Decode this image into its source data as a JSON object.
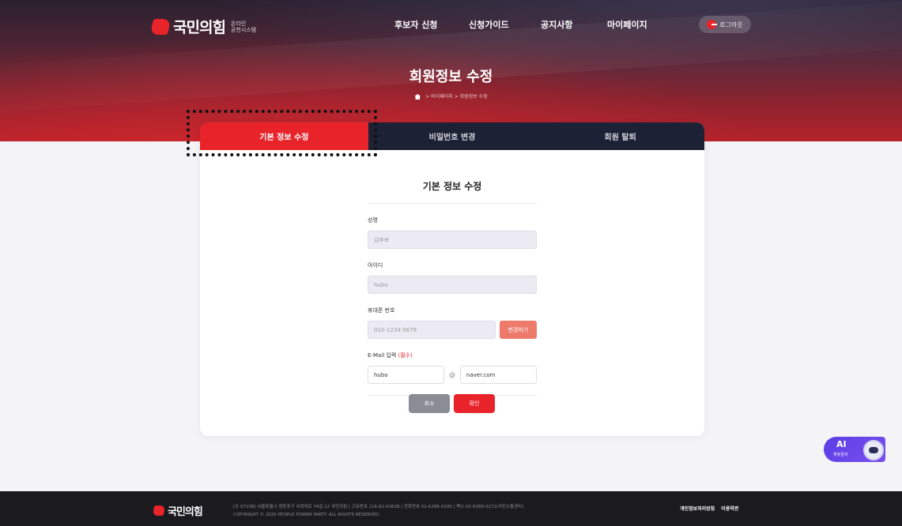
{
  "header": {
    "logo_text": "국민의힘",
    "logo_sub_line1": "온라인",
    "logo_sub_line2": "공천시스템",
    "nav": [
      "후보자 신청",
      "신청가이드",
      "공지사항",
      "마이페이지"
    ],
    "logout_label": "로그아웃"
  },
  "page": {
    "title": "회원정보 수정",
    "breadcrumb": [
      "마이페이지",
      "회원정보 수정"
    ]
  },
  "tabs": [
    {
      "label": "기본 정보 수정",
      "active": true
    },
    {
      "label": "비밀번호 변경",
      "active": false
    },
    {
      "label": "회원 탈퇴",
      "active": false
    }
  ],
  "form": {
    "title": "기본 정보 수정",
    "name_label": "성명",
    "name_value": "김후보",
    "id_label": "아이디",
    "id_value": "hubo",
    "phone_label": "휴대폰 번호",
    "phone_value": "010-1234-5678",
    "phone_change_button": "변경하기",
    "email_label": "E-Mail 입력",
    "email_required": "(필수)",
    "email_local": "hubo",
    "email_at": "@",
    "email_domain": "naver.com",
    "cancel_button": "취소",
    "confirm_button": "확인"
  },
  "chatbot": {
    "title": "AI",
    "subtitle": "챗봇문의"
  },
  "footer": {
    "logo_text": "국민의힘",
    "info_line1": "[우 07238] 서울특별시 영등포구 국회대로 74길 12 국민의힘  |  고유번호 116-82-03628  |  전화번호 02-6288-0200  |  팩스 02-6288-0272(국민소통센터)",
    "info_line2": "COPYRIGHT © 2020 PEOPLE POWER PARTY. ALL RIGHTS RESERVED.",
    "links": [
      "개인정보처리방침",
      "이용약관"
    ]
  },
  "colors": {
    "brand_red": "#e8232a",
    "tab_bar": "#1d2135",
    "footer_bg": "#1b1b1f"
  }
}
